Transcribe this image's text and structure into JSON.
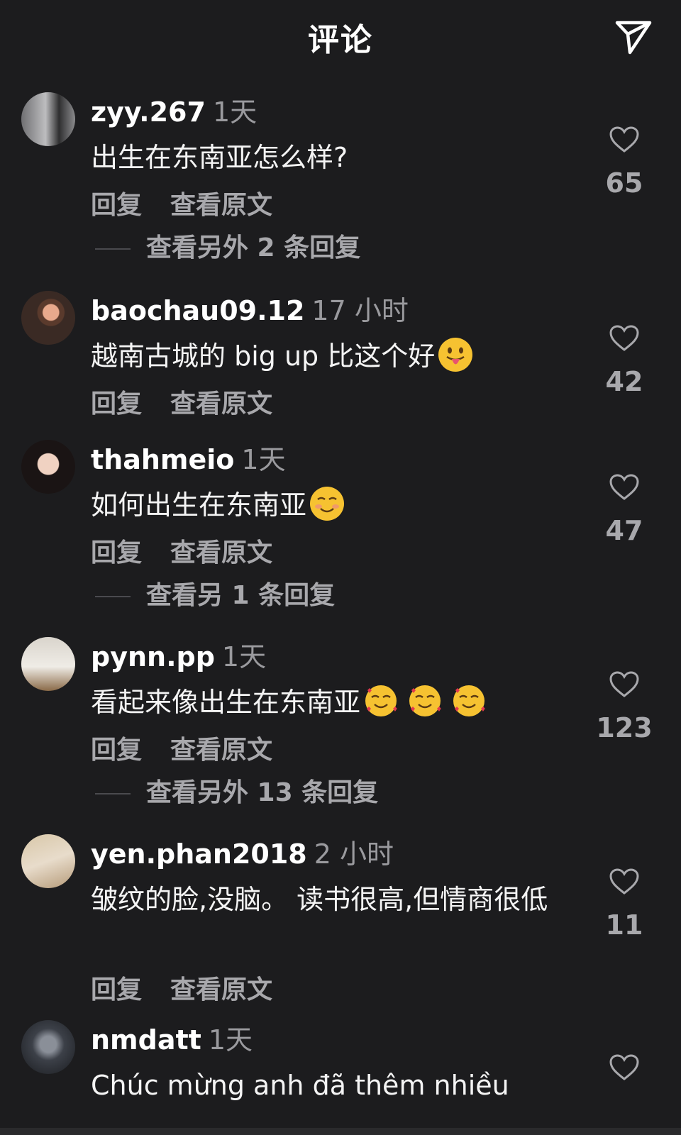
{
  "header": {
    "title": "评论"
  },
  "colors": {
    "background": "#1c1c1e",
    "text_primary": "#ffffff",
    "text_secondary": "#a8a8ac",
    "emoji_yellow": "#f6c231"
  },
  "comments": [
    {
      "username": "zyy.267",
      "time": "1天",
      "text": "出生在东南亚怎么样?",
      "emoji": "",
      "reply_label": "回复",
      "translate_label": "查看原文",
      "more_replies": "查看另外 2 条回复",
      "likes": "65"
    },
    {
      "username": "baochau09.12",
      "time": "17 小时",
      "text": "越南古城的 big up 比这个好",
      "emoji": "face-with-tongue-emoji",
      "reply_label": "回复",
      "translate_label": "查看原文",
      "more_replies": "",
      "likes": "42"
    },
    {
      "username": "thahmeio",
      "time": "1天",
      "text": "如何出生在东南亚",
      "emoji": "smiling-face-emoji",
      "reply_label": "回复",
      "translate_label": "查看原文",
      "more_replies": "查看另 1 条回复",
      "likes": "47"
    },
    {
      "username": "pynn.pp",
      "time": "1天",
      "text": "看起来像出生在东南亚",
      "emoji": "smiling-face-with-hearts-emoji",
      "reply_label": "回复",
      "translate_label": "查看原文",
      "more_replies": "查看另外 13 条回复",
      "likes": "123"
    },
    {
      "username": "yen.phan2018",
      "time": "2 小时",
      "text": "皱纹的脸,没脑。 读书很高,但情商很低",
      "emoji": "",
      "reply_label": "回复",
      "translate_label": "查看原文",
      "more_replies": "",
      "likes": "11"
    },
    {
      "username": "nmdatt",
      "time": "1天",
      "text": "Chúc mừng anh đã thêm nhiều",
      "emoji": "",
      "reply_label": "",
      "translate_label": "",
      "more_replies": "",
      "likes": ""
    }
  ]
}
